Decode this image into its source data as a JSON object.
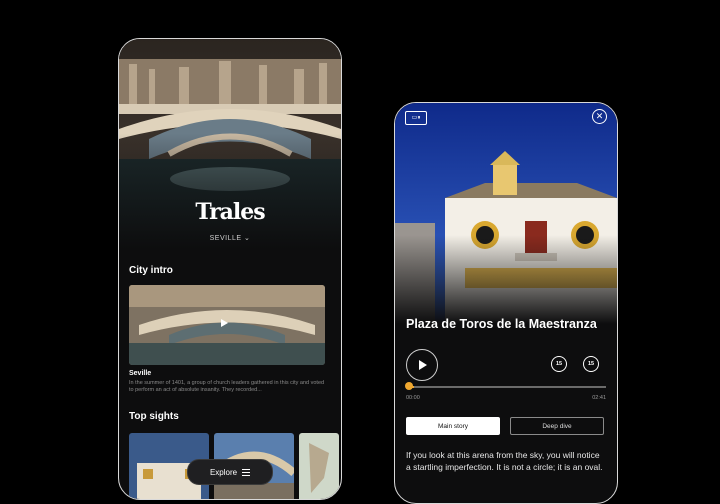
{
  "phone1": {
    "brand": "Trales",
    "city": "SEVILLE",
    "city_intro_title": "City intro",
    "intro_video_title": "Seville",
    "intro_text": "In the summer of 1401, a group of church leaders gathered in this city and voted to perform an act of absolute insanity. They recorded...",
    "top_sights_title": "Top sights",
    "explore_label": "Explore"
  },
  "phone2": {
    "place_title": "Plaza de Toros de la Maestranza",
    "skip_back_label": "15",
    "skip_forward_label": "15",
    "progress": 0.02,
    "time_current": "00:00",
    "time_total": "02:41",
    "tabs": [
      "Main story",
      "Deep dive"
    ],
    "active_tab": "Main story",
    "story_text": "If you look at this arena from the sky, you will notice a startling imperfection. It is not a circle; it is an oval."
  },
  "colors": {
    "accent": "#f0a830",
    "background": "#000000",
    "phone_bg": "#0d0d0e"
  }
}
